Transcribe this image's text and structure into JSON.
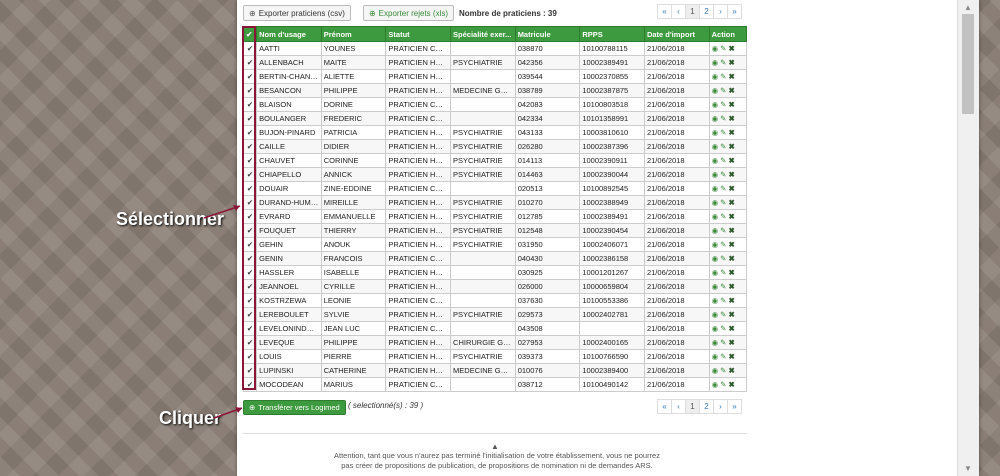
{
  "toolbar": {
    "export_csv_label": "Exporter praticiens (csv)",
    "export_rejects_label": "Exporter rejets (xls)",
    "count_text": "Nombre de praticiens : 39"
  },
  "pagination": {
    "first": "«",
    "prev": "‹",
    "pages": [
      "1",
      "2"
    ],
    "next": "›",
    "last": "»",
    "active_page": "1"
  },
  "table": {
    "columns": [
      "Nom d'usage",
      "Prénom",
      "Statut",
      "Spécialité exer...",
      "Matricule",
      "RPPS",
      "Date d'import",
      "Action"
    ],
    "rows": [
      [
        "AATTI",
        "YOUNES",
        "PRATICIEN CON...",
        "",
        "038870",
        "10100788115",
        "21/06/2018"
      ],
      [
        "ALLENBACH",
        "MAITE",
        "PRATICIEN HOS...",
        "PSYCHIATRIE",
        "042356",
        "10002389491",
        "21/06/2018"
      ],
      [
        "BERTIN-CHANS...",
        "ALIETTE",
        "PRATICIEN HOS...",
        "",
        "039544",
        "10002370855",
        "21/06/2018"
      ],
      [
        "BESANCON",
        "PHILIPPE",
        "PRATICIEN HOS...",
        "MEDECINE GEN...",
        "038789",
        "10002387875",
        "21/06/2018"
      ],
      [
        "BLAISON",
        "DORINE",
        "PRATICIEN CON...",
        "",
        "042083",
        "10100803518",
        "21/06/2018"
      ],
      [
        "BOULANGER",
        "FREDERIC",
        "PRATICIEN CON...",
        "",
        "042334",
        "10101358991",
        "21/06/2018"
      ],
      [
        "BUJON-PINARD",
        "PATRICIA",
        "PRATICIEN HOS...",
        "PSYCHIATRIE",
        "043133",
        "10003810610",
        "21/06/2018"
      ],
      [
        "CAILLE",
        "DIDIER",
        "PRATICIEN HOS...",
        "PSYCHIATRIE",
        "026280",
        "10002387396",
        "21/06/2018"
      ],
      [
        "CHAUVET",
        "CORINNE",
        "PRATICIEN HOS...",
        "PSYCHIATRIE",
        "014113",
        "10002390911",
        "21/06/2018"
      ],
      [
        "CHIAPELLO",
        "ANNICK",
        "PRATICIEN HOS...",
        "PSYCHIATRIE",
        "014463",
        "10002390044",
        "21/06/2018"
      ],
      [
        "DOUAIR",
        "ZINE-EDDINE",
        "PRATICIEN CON...",
        "",
        "020513",
        "10100892545",
        "21/06/2018"
      ],
      [
        "DURAND-HUMB...",
        "MIREILLE",
        "PRATICIEN HOS...",
        "PSYCHIATRIE",
        "010270",
        "10002388949",
        "21/06/2018"
      ],
      [
        "EVRARD",
        "EMMANUELLE",
        "PRATICIEN HOS...",
        "PSYCHIATRIE",
        "012785",
        "10002389491",
        "21/06/2018"
      ],
      [
        "FOUQUET",
        "THIERRY",
        "PRATICIEN HOS...",
        "PSYCHIATRIE",
        "012548",
        "10002390454",
        "21/06/2018"
      ],
      [
        "GEHIN",
        "ANOUK",
        "PRATICIEN HOS...",
        "PSYCHIATRIE",
        "031950",
        "10002406071",
        "21/06/2018"
      ],
      [
        "GENIN",
        "FRANCOIS",
        "PRATICIEN CON...",
        "",
        "040430",
        "10002386158",
        "21/06/2018"
      ],
      [
        "HASSLER",
        "ISABELLE",
        "PRATICIEN HOS...",
        "",
        "030925",
        "10001201267",
        "21/06/2018"
      ],
      [
        "JEANNOEL",
        "CYRILLE",
        "PRATICIEN HOS...",
        "",
        "026000",
        "10000659804",
        "21/06/2018"
      ],
      [
        "KOSTRZEWA",
        "LEONIE",
        "PRATICIEN CON...",
        "",
        "037630",
        "10100553386",
        "21/06/2018"
      ],
      [
        "LEREBOULET",
        "SYLVIE",
        "PRATICIEN HOS...",
        "PSYCHIATRIE",
        "029573",
        "10002402781",
        "21/06/2018"
      ],
      [
        "LEVELONINDRA...",
        "JEAN LUC",
        "PRATICIEN CON...",
        "",
        "043508",
        "",
        "21/06/2018"
      ],
      [
        "LEVEQUE",
        "PHILIPPE",
        "PRATICIEN HOS...",
        "CHIRURGIE GEN...",
        "027953",
        "10002400165",
        "21/06/2018"
      ],
      [
        "LOUIS",
        "PIERRE",
        "PRATICIEN HOS...",
        "PSYCHIATRIE",
        "039373",
        "10100766590",
        "21/06/2018"
      ],
      [
        "LUPINSKI",
        "CATHERINE",
        "PRATICIEN HOS...",
        "MEDECINE GEN...",
        "010076",
        "10002389400",
        "21/06/2018"
      ],
      [
        "MOCODEAN",
        "MARIUS",
        "PRATICIEN CON...",
        "",
        "038712",
        "10100490142",
        "21/06/2018"
      ]
    ]
  },
  "footer": {
    "transfer_label": "Transférer vers Logimed",
    "selected_text": "( selectionné(s) : 39 )",
    "warning_line1": "Attention, tant que vous n'aurez pas terminé l'initialisation de votre établissement, vous ne pourrez",
    "warning_line2": "pas créer de propositions de publication, de propositions de nomination ni de demandes ARS."
  },
  "annotations": {
    "select_label": "Sélectionner",
    "click_label": "Cliquer"
  },
  "colors": {
    "header_green": "#3e9a3e",
    "highlight": "#8b1538"
  }
}
